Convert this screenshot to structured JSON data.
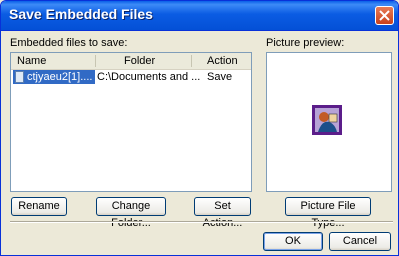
{
  "window": {
    "title": "Save Embedded Files"
  },
  "list": {
    "label": "Embedded files to save:",
    "columns": [
      "Name",
      "Folder",
      "Action"
    ],
    "rows": [
      {
        "name": "ctjyaeu2[1]....",
        "folder": "C:\\Documents and ...",
        "action": "Save"
      }
    ]
  },
  "preview": {
    "label": "Picture preview:"
  },
  "buttons": {
    "rename": "Rename",
    "change_folder": "Change Folder...",
    "set_action": "Set Action...",
    "picture_file_type": "Picture File Type...",
    "ok": "OK",
    "cancel": "Cancel"
  },
  "colors": {
    "titlebar": "#0054e3",
    "selection": "#316ac5",
    "close": "#d5441a"
  }
}
